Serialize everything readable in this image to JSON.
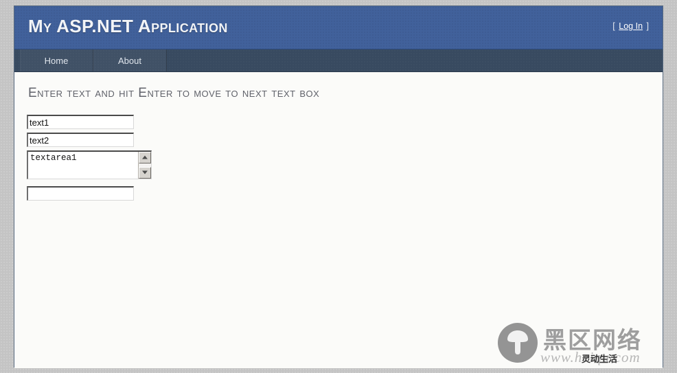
{
  "header": {
    "site_title": "My ASP.NET Application",
    "login_bracket_open": "[",
    "login_label": "Log In",
    "login_bracket_close": "]"
  },
  "nav": {
    "items": [
      {
        "label": "Home"
      },
      {
        "label": "About"
      }
    ]
  },
  "content": {
    "heading": "Enter text and hit Enter to move to next text box",
    "fields": [
      {
        "name": "text1-input",
        "value": "text1",
        "placeholder": ""
      },
      {
        "name": "text2-input",
        "value": "text2",
        "placeholder": ""
      },
      {
        "name": "textarea1",
        "value": "textarea1",
        "placeholder": ""
      },
      {
        "name": "text3-input",
        "value": "",
        "placeholder": ""
      }
    ]
  },
  "watermark": {
    "brand_cn": "黑区网络",
    "url": "www.heiqu.com",
    "slogan_cn": "灵动生活"
  },
  "colors": {
    "header_blue": "#41619b",
    "nav_dark": "#384a60",
    "page_grey": "#c4c4c4",
    "content_bg": "#fbfbf9",
    "heading_text": "#60626a",
    "container_border": "#56687e"
  }
}
